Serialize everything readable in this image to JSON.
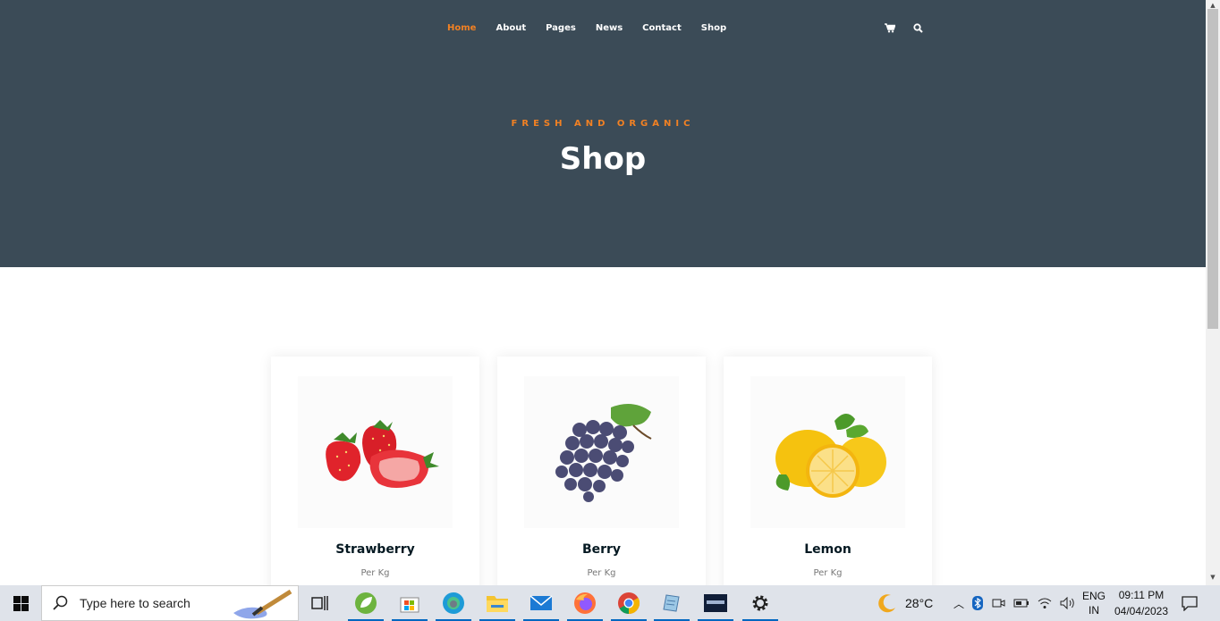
{
  "nav": {
    "items": [
      "Home",
      "About",
      "Pages",
      "News",
      "Contact",
      "Shop"
    ],
    "active": "Home",
    "cart_icon": "cart-icon",
    "search_icon": "search-icon"
  },
  "hero": {
    "subtitle": "FRESH AND ORGANIC",
    "title": "Shop"
  },
  "products": [
    {
      "name": "Strawberry",
      "unit": "Per Kg",
      "image": "strawberry-image"
    },
    {
      "name": "Berry",
      "unit": "Per Kg",
      "image": "grapes-image"
    },
    {
      "name": "Lemon",
      "unit": "Per Kg",
      "image": "lemon-image"
    }
  ],
  "taskbar": {
    "search_placeholder": "Type here to search",
    "apps": [
      "task-view-icon",
      "spring-tool-icon",
      "microsoft-store-icon",
      "edge-beta-icon",
      "file-explorer-icon",
      "mail-icon",
      "firefox-icon",
      "chrome-icon",
      "notepad-icon",
      "mysql-icon",
      "settings-icon"
    ],
    "weather": "28°C",
    "language": "ENG",
    "region": "IN",
    "time": "09:11 PM",
    "date": "04/04/2023"
  },
  "colors": {
    "hero_bg": "#3b4b57",
    "accent": "#f28123",
    "taskbar_bg": "#dfe3ea"
  }
}
